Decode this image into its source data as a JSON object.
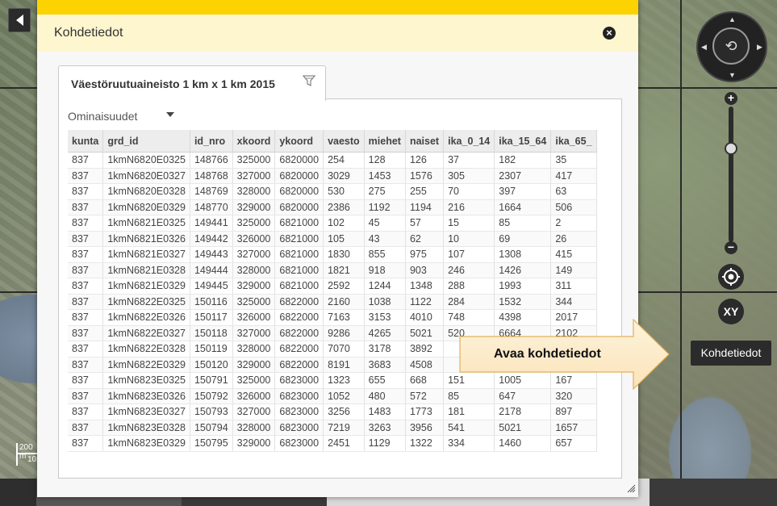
{
  "dialog": {
    "title": "Kohdetiedot",
    "close_icon": "close-icon",
    "tab": {
      "label": "Väestöruutuaineisto 1 km x 1 km 2015",
      "filter_icon": "filter-icon"
    },
    "properties_label": "Ominaisuudet",
    "table": {
      "columns": [
        "kunta",
        "grd_id",
        "id_nro",
        "xkoord",
        "ykoord",
        "vaesto",
        "miehet",
        "naiset",
        "ika_0_14",
        "ika_15_64",
        "ika_65_"
      ],
      "rows": [
        [
          "837",
          "1kmN6820E0325",
          "148766",
          "325000",
          "6820000",
          "254",
          "128",
          "126",
          "37",
          "182",
          "35"
        ],
        [
          "837",
          "1kmN6820E0327",
          "148768",
          "327000",
          "6820000",
          "3029",
          "1453",
          "1576",
          "305",
          "2307",
          "417"
        ],
        [
          "837",
          "1kmN6820E0328",
          "148769",
          "328000",
          "6820000",
          "530",
          "275",
          "255",
          "70",
          "397",
          "63"
        ],
        [
          "837",
          "1kmN6820E0329",
          "148770",
          "329000",
          "6820000",
          "2386",
          "1192",
          "1194",
          "216",
          "1664",
          "506"
        ],
        [
          "837",
          "1kmN6821E0325",
          "149441",
          "325000",
          "6821000",
          "102",
          "45",
          "57",
          "15",
          "85",
          "2"
        ],
        [
          "837",
          "1kmN6821E0326",
          "149442",
          "326000",
          "6821000",
          "105",
          "43",
          "62",
          "10",
          "69",
          "26"
        ],
        [
          "837",
          "1kmN6821E0327",
          "149443",
          "327000",
          "6821000",
          "1830",
          "855",
          "975",
          "107",
          "1308",
          "415"
        ],
        [
          "837",
          "1kmN6821E0328",
          "149444",
          "328000",
          "6821000",
          "1821",
          "918",
          "903",
          "246",
          "1426",
          "149"
        ],
        [
          "837",
          "1kmN6821E0329",
          "149445",
          "329000",
          "6821000",
          "2592",
          "1244",
          "1348",
          "288",
          "1993",
          "311"
        ],
        [
          "837",
          "1kmN6822E0325",
          "150116",
          "325000",
          "6822000",
          "2160",
          "1038",
          "1122",
          "284",
          "1532",
          "344"
        ],
        [
          "837",
          "1kmN6822E0326",
          "150117",
          "326000",
          "6822000",
          "7163",
          "3153",
          "4010",
          "748",
          "4398",
          "2017"
        ],
        [
          "837",
          "1kmN6822E0327",
          "150118",
          "327000",
          "6822000",
          "9286",
          "4265",
          "5021",
          "520",
          "6664",
          "2102"
        ],
        [
          "837",
          "1kmN6822E0328",
          "150119",
          "328000",
          "6822000",
          "7070",
          "3178",
          "3892",
          "",
          "",
          ""
        ],
        [
          "837",
          "1kmN6822E0329",
          "150120",
          "329000",
          "6822000",
          "8191",
          "3683",
          "4508",
          "",
          "",
          ""
        ],
        [
          "837",
          "1kmN6823E0325",
          "150791",
          "325000",
          "6823000",
          "1323",
          "655",
          "668",
          "151",
          "1005",
          "167"
        ],
        [
          "837",
          "1kmN6823E0326",
          "150792",
          "326000",
          "6823000",
          "1052",
          "480",
          "572",
          "85",
          "647",
          "320"
        ],
        [
          "837",
          "1kmN6823E0327",
          "150793",
          "327000",
          "6823000",
          "3256",
          "1483",
          "1773",
          "181",
          "2178",
          "897"
        ],
        [
          "837",
          "1kmN6823E0328",
          "150794",
          "328000",
          "6823000",
          "7219",
          "3263",
          "3956",
          "541",
          "5021",
          "1657"
        ],
        [
          "837",
          "1kmN6823E0329",
          "150795",
          "329000",
          "6823000",
          "2451",
          "1129",
          "1322",
          "334",
          "1460",
          "657"
        ]
      ]
    }
  },
  "callout": {
    "text": "Avaa kohdetiedot"
  },
  "map_controls": {
    "kohdetiedot_label": "Kohdetiedot",
    "xy_label": "XY",
    "zoom_in": "+",
    "zoom_out": "−"
  },
  "scale": {
    "top": "200 m",
    "bottom": "10"
  },
  "colors": {
    "accent_yellow": "#fcd300",
    "header_bg": "#fdf6cf",
    "callout_fill": "#fdeed1"
  }
}
